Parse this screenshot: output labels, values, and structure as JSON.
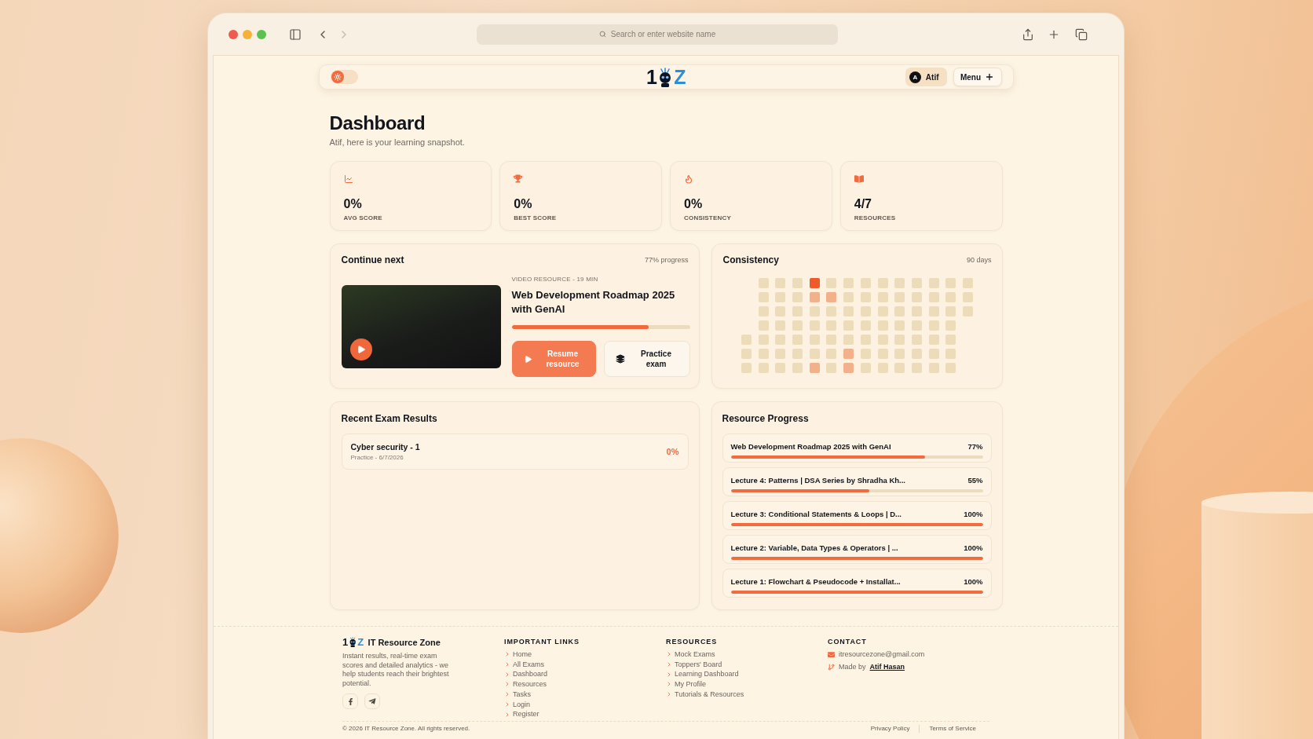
{
  "browser": {
    "back": {
      "disabled": false
    },
    "forward": {
      "disabled": true
    },
    "address_placeholder": "Search or enter website name"
  },
  "header": {
    "theme_toggle": {
      "on": false
    },
    "logo": {
      "lead": "1",
      "trail": "Z"
    },
    "user": {
      "initial": "A",
      "name": "Atif"
    },
    "menu_label": "Menu"
  },
  "dashboard": {
    "title": "Dashboard",
    "subtitle": "Atif, here is your learning snapshot."
  },
  "stats": [
    {
      "value": "0%",
      "label": "AVG SCORE"
    },
    {
      "value": "0%",
      "label": "BEST SCORE"
    },
    {
      "value": "0%",
      "label": "CONSISTENCY"
    },
    {
      "value": "4/7",
      "label": "RESOURCES"
    }
  ],
  "continue_next": {
    "title": "Continue next",
    "progress_text": "77% progress",
    "meta": "VIDEO RESOURCE - 19 MIN",
    "resource_title": "Web Development Roadmap 2025 with GenAI",
    "level": 0.77,
    "buttons": [
      {
        "kind": "primary",
        "label": "Resume resource"
      },
      {
        "kind": "secondary",
        "label": "Practice exam"
      }
    ]
  },
  "consistency": {
    "title": "Consistency",
    "range": "90 days",
    "weeks": [
      {
        "days": [
          {
            "color": "#ecdcb9"
          },
          {
            "color": "#ecdcb9"
          },
          {
            "color": "#ecdcb9"
          }
        ]
      },
      {
        "days": [
          {
            "color": "#ecdcb9"
          },
          {
            "color": "#ecdcb9"
          },
          {
            "color": "#ecdcb9"
          },
          {
            "color": "#ecdcb9"
          },
          {
            "color": "#ecdcb9"
          },
          {
            "color": "#ecdcb9"
          },
          {
            "color": "#ecdcb9"
          }
        ]
      },
      {
        "days": [
          {
            "color": "#ecdcb9"
          },
          {
            "color": "#ecdcb9"
          },
          {
            "color": "#ecdcb9"
          },
          {
            "color": "#ecdcb9"
          },
          {
            "color": "#ecdcb9"
          },
          {
            "color": "#ecdcb9"
          },
          {
            "color": "#ecdcb9"
          }
        ]
      },
      {
        "days": [
          {
            "color": "#ecdcb9"
          },
          {
            "color": "#ecdcb9"
          },
          {
            "color": "#ecdcb9"
          },
          {
            "color": "#ecdcb9"
          },
          {
            "color": "#ecdcb9"
          },
          {
            "color": "#ecdcb9"
          },
          {
            "color": "#ecdcb9"
          }
        ]
      },
      {
        "days": [
          {
            "color": "#f05a2a"
          },
          {
            "color": "#f2b18b"
          },
          {
            "color": "#ecdcb9"
          },
          {
            "color": "#ecdcb9"
          },
          {
            "color": "#ecdcb9"
          },
          {
            "color": "#ecdcb9"
          },
          {
            "color": "#f2b18b"
          }
        ]
      },
      {
        "days": [
          {
            "color": "#ecdcb9"
          },
          {
            "color": "#f2b18b"
          },
          {
            "color": "#ecdcb9"
          },
          {
            "color": "#ecdcb9"
          },
          {
            "color": "#ecdcb9"
          },
          {
            "color": "#ecdcb9"
          },
          {
            "color": "#ecdcb9"
          }
        ]
      },
      {
        "days": [
          {
            "color": "#ecdcb9"
          },
          {
            "color": "#ecdcb9"
          },
          {
            "color": "#ecdcb9"
          },
          {
            "color": "#ecdcb9"
          },
          {
            "color": "#ecdcb9"
          },
          {
            "color": "#f2b18b"
          },
          {
            "color": "#f2b18b"
          }
        ]
      },
      {
        "days": [
          {
            "color": "#ecdcb9"
          },
          {
            "color": "#ecdcb9"
          },
          {
            "color": "#ecdcb9"
          },
          {
            "color": "#ecdcb9"
          },
          {
            "color": "#ecdcb9"
          },
          {
            "color": "#ecdcb9"
          },
          {
            "color": "#ecdcb9"
          }
        ]
      },
      {
        "days": [
          {
            "color": "#ecdcb9"
          },
          {
            "color": "#ecdcb9"
          },
          {
            "color": "#ecdcb9"
          },
          {
            "color": "#ecdcb9"
          },
          {
            "color": "#ecdcb9"
          },
          {
            "color": "#ecdcb9"
          },
          {
            "color": "#ecdcb9"
          }
        ]
      },
      {
        "days": [
          {
            "color": "#ecdcb9"
          },
          {
            "color": "#ecdcb9"
          },
          {
            "color": "#ecdcb9"
          },
          {
            "color": "#ecdcb9"
          },
          {
            "color": "#ecdcb9"
          },
          {
            "color": "#ecdcb9"
          },
          {
            "color": "#ecdcb9"
          }
        ]
      },
      {
        "days": [
          {
            "color": "#ecdcb9"
          },
          {
            "color": "#ecdcb9"
          },
          {
            "color": "#ecdcb9"
          },
          {
            "color": "#ecdcb9"
          },
          {
            "color": "#ecdcb9"
          },
          {
            "color": "#ecdcb9"
          },
          {
            "color": "#ecdcb9"
          }
        ]
      },
      {
        "days": [
          {
            "color": "#ecdcb9"
          },
          {
            "color": "#ecdcb9"
          },
          {
            "color": "#ecdcb9"
          },
          {
            "color": "#ecdcb9"
          },
          {
            "color": "#ecdcb9"
          },
          {
            "color": "#ecdcb9"
          },
          {
            "color": "#ecdcb9"
          }
        ]
      },
      {
        "days": [
          {
            "color": "#ecdcb9"
          },
          {
            "color": "#ecdcb9"
          },
          {
            "color": "#ecdcb9"
          },
          {
            "color": "#ecdcb9"
          },
          {
            "color": "#ecdcb9"
          },
          {
            "color": "#ecdcb9"
          },
          {
            "color": "#ecdcb9"
          }
        ]
      },
      {
        "days": [
          {
            "color": "#ecdcb9"
          },
          {
            "color": "#ecdcb9"
          },
          {
            "color": "#ecdcb9"
          }
        ]
      }
    ]
  },
  "recent_exams": {
    "title": "Recent Exam Results",
    "rows": [
      {
        "name": "Cyber security - 1",
        "detail": "Practice - 6/7/2026",
        "score": "0%"
      }
    ]
  },
  "resource_progress": {
    "title": "Resource Progress",
    "items": [
      {
        "title": "Web Development Roadmap 2025 with GenAI",
        "percent": "77%",
        "level": 0.77
      },
      {
        "title": "Lecture 4: Patterns | DSA Series by Shradha Kh...",
        "percent": "55%",
        "level": 0.55
      },
      {
        "title": "Lecture 3: Conditional Statements & Loops | D...",
        "percent": "100%",
        "level": 1
      },
      {
        "title": "Lecture 2: Variable, Data Types & Operators | ...",
        "percent": "100%",
        "level": 1
      },
      {
        "title": "Lecture 1: Flowchart & Pseudocode + Installat...",
        "percent": "100%",
        "level": 1
      }
    ]
  },
  "footer": {
    "brand": {
      "logo": {
        "lead": "1",
        "trail": "Z"
      },
      "name": "IT Resource Zone",
      "description": "Instant results, real-time exam scores and detailed analytics - we help students reach their brightest potential."
    },
    "link_columns": [
      {
        "heading": "IMPORTANT LINKS",
        "links": [
          "Home",
          "All Exams",
          "Dashboard",
          "Resources",
          "Tasks",
          "Login",
          "Register"
        ]
      },
      {
        "heading": "RESOURCES",
        "links": [
          "Mock Exams",
          "Toppers' Board",
          "Learning Dashboard",
          "My Profile",
          "Tutorials & Resources"
        ]
      }
    ],
    "contact": {
      "heading": "CONTACT",
      "email": "itresourcezone@gmail.com",
      "credit_label": "Made by",
      "credit_name": "Atif Hasan"
    },
    "copyright": "© 2026 IT Resource Zone. All rights reserved.",
    "legal_links": [
      "Privacy Policy",
      "Terms of Service"
    ]
  }
}
